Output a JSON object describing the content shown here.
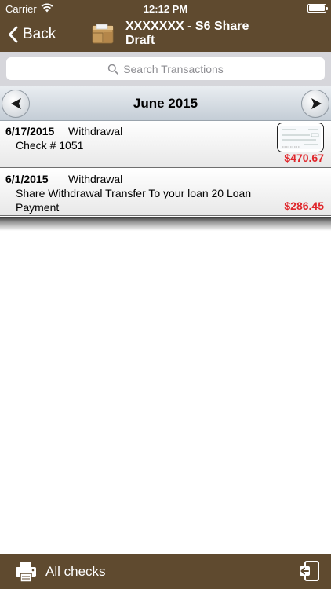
{
  "status_bar": {
    "carrier": "Carrier",
    "time": "12:12 PM",
    "wifi_icon": "wifi-icon",
    "battery_icon": "battery-icon"
  },
  "nav": {
    "back_label": "Back",
    "title": "XXXXXXX - S6 Share Draft",
    "account_icon": "wallet-icon"
  },
  "search": {
    "placeholder": "Search Transactions"
  },
  "month_bar": {
    "label": "June 2015",
    "prev_icon": "arrow-left-icon",
    "next_icon": "arrow-right-icon"
  },
  "transactions": [
    {
      "date": "6/17/2015",
      "type": "Withdrawal",
      "description": "Check # 1051",
      "amount": "$470.67",
      "has_check_image": true
    },
    {
      "date": "6/1/2015",
      "type": "Withdrawal",
      "description": "Share Withdrawal Transfer To your loan 20 Loan Payment",
      "amount": "$286.45",
      "has_check_image": false
    }
  ],
  "footer": {
    "all_checks_label": "All checks",
    "printer_icon": "printer-icon",
    "exit_icon": "exit-icon"
  },
  "colors": {
    "bar_brown": "#5f4a2f",
    "amount_red": "#e0262b",
    "search_gray": "#d6d6db"
  }
}
